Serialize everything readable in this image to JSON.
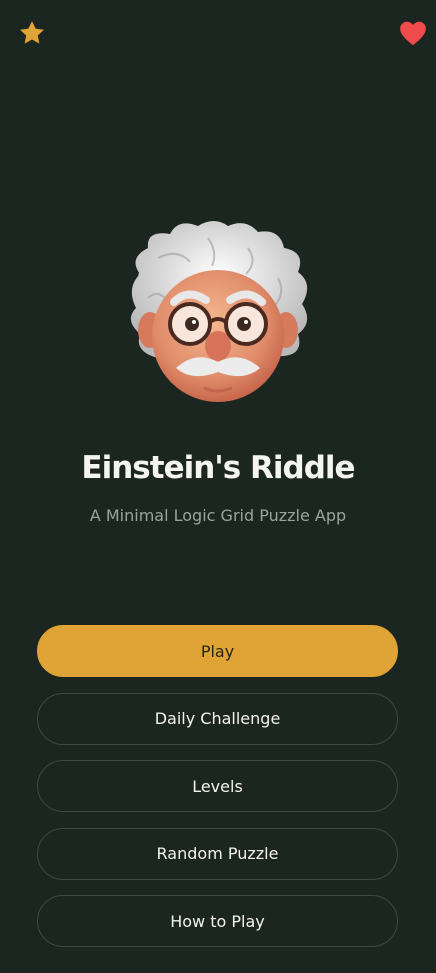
{
  "app": {
    "title": "Einstein's Riddle",
    "subtitle": "A Minimal Logic Grid Puzzle App"
  },
  "header": {
    "left_icon": "star-icon",
    "right_icon": "heart-icon"
  },
  "menu": {
    "play": "Play",
    "daily_challenge": "Daily Challenge",
    "levels": "Levels",
    "random_puzzle": "Random Puzzle",
    "how_to_play": "How to Play"
  },
  "colors": {
    "background": "#1c2620",
    "accent": "#e0a336",
    "star": "#e0a336",
    "heart": "#ef4b4b",
    "button_border": "#3b4a41",
    "subtitle": "#9aa39c"
  }
}
